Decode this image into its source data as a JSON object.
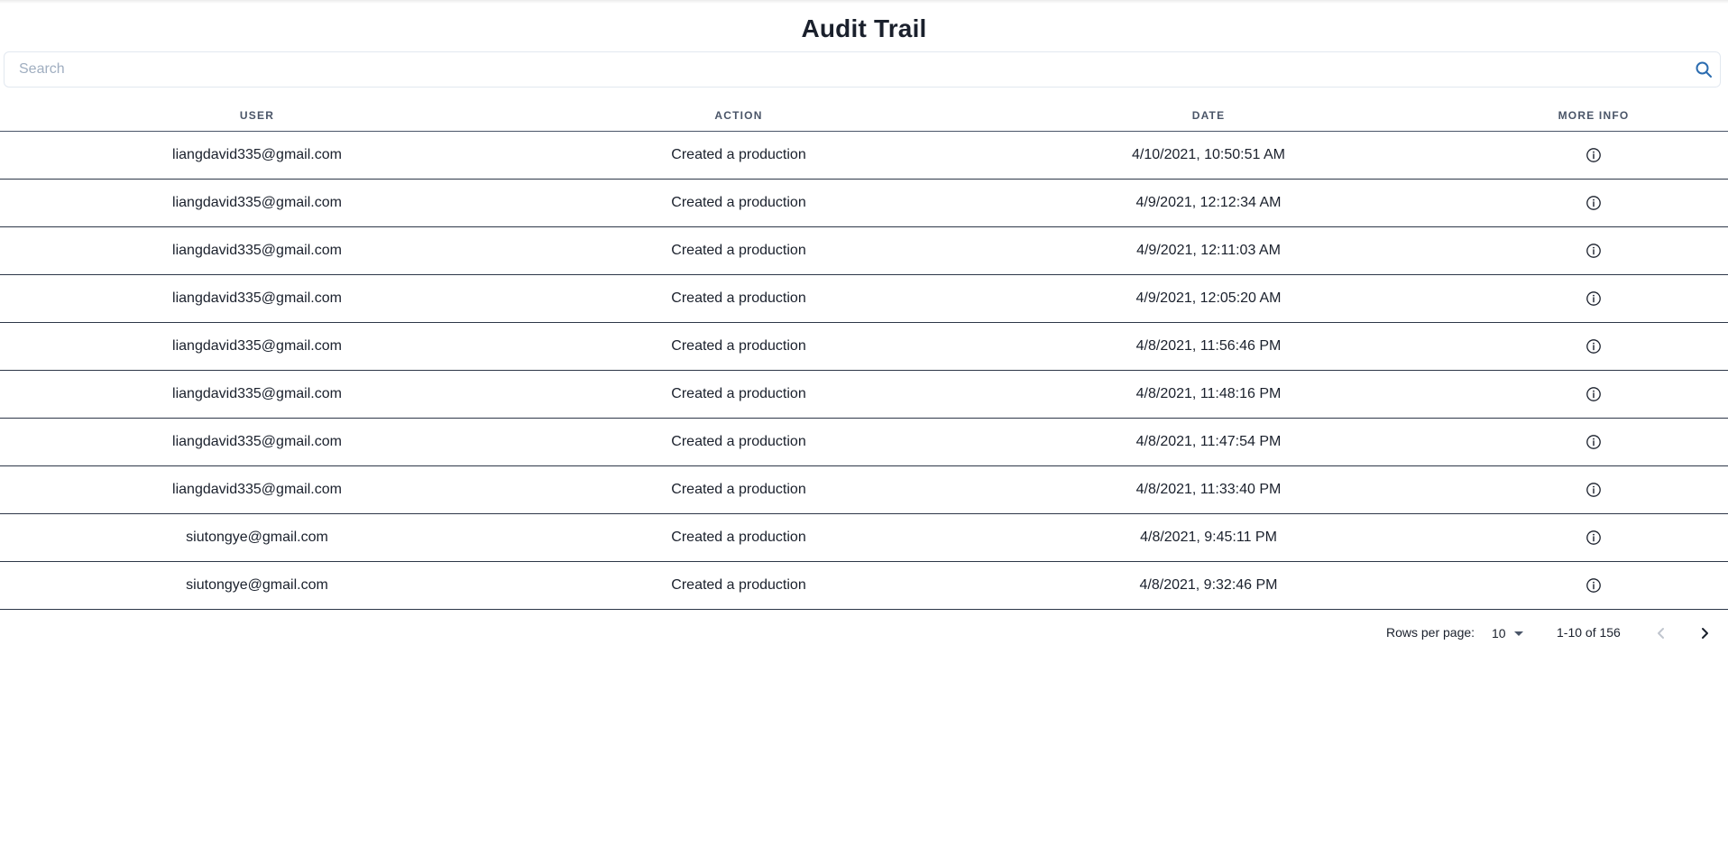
{
  "page": {
    "title": "Audit Trail"
  },
  "search": {
    "placeholder": "Search",
    "value": ""
  },
  "table": {
    "columns": [
      "USER",
      "ACTION",
      "DATE",
      "MORE INFO"
    ],
    "rows": [
      {
        "user": "liangdavid335@gmail.com",
        "action": "Created a production",
        "date": "4/10/2021, 10:50:51 AM"
      },
      {
        "user": "liangdavid335@gmail.com",
        "action": "Created a production",
        "date": "4/9/2021, 12:12:34 AM"
      },
      {
        "user": "liangdavid335@gmail.com",
        "action": "Created a production",
        "date": "4/9/2021, 12:11:03 AM"
      },
      {
        "user": "liangdavid335@gmail.com",
        "action": "Created a production",
        "date": "4/9/2021, 12:05:20 AM"
      },
      {
        "user": "liangdavid335@gmail.com",
        "action": "Created a production",
        "date": "4/8/2021, 11:56:46 PM"
      },
      {
        "user": "liangdavid335@gmail.com",
        "action": "Created a production",
        "date": "4/8/2021, 11:48:16 PM"
      },
      {
        "user": "liangdavid335@gmail.com",
        "action": "Created a production",
        "date": "4/8/2021, 11:47:54 PM"
      },
      {
        "user": "liangdavid335@gmail.com",
        "action": "Created a production",
        "date": "4/8/2021, 11:33:40 PM"
      },
      {
        "user": "siutongye@gmail.com",
        "action": "Created a production",
        "date": "4/8/2021, 9:45:11 PM"
      },
      {
        "user": "siutongye@gmail.com",
        "action": "Created a production",
        "date": "4/8/2021, 9:32:46 PM"
      }
    ],
    "row_icon": "info-circle-icon"
  },
  "pagination": {
    "rows_per_page_label": "Rows per page:",
    "rows_per_page_value": "10",
    "range_text": "1-10 of 156",
    "prev_icon": "chevron-left-icon",
    "next_icon": "chevron-right-icon"
  },
  "colors": {
    "accent": "#2b6cb0",
    "text": "#1a202c",
    "muted": "#a0aec0",
    "border": "#e2e8f0"
  }
}
